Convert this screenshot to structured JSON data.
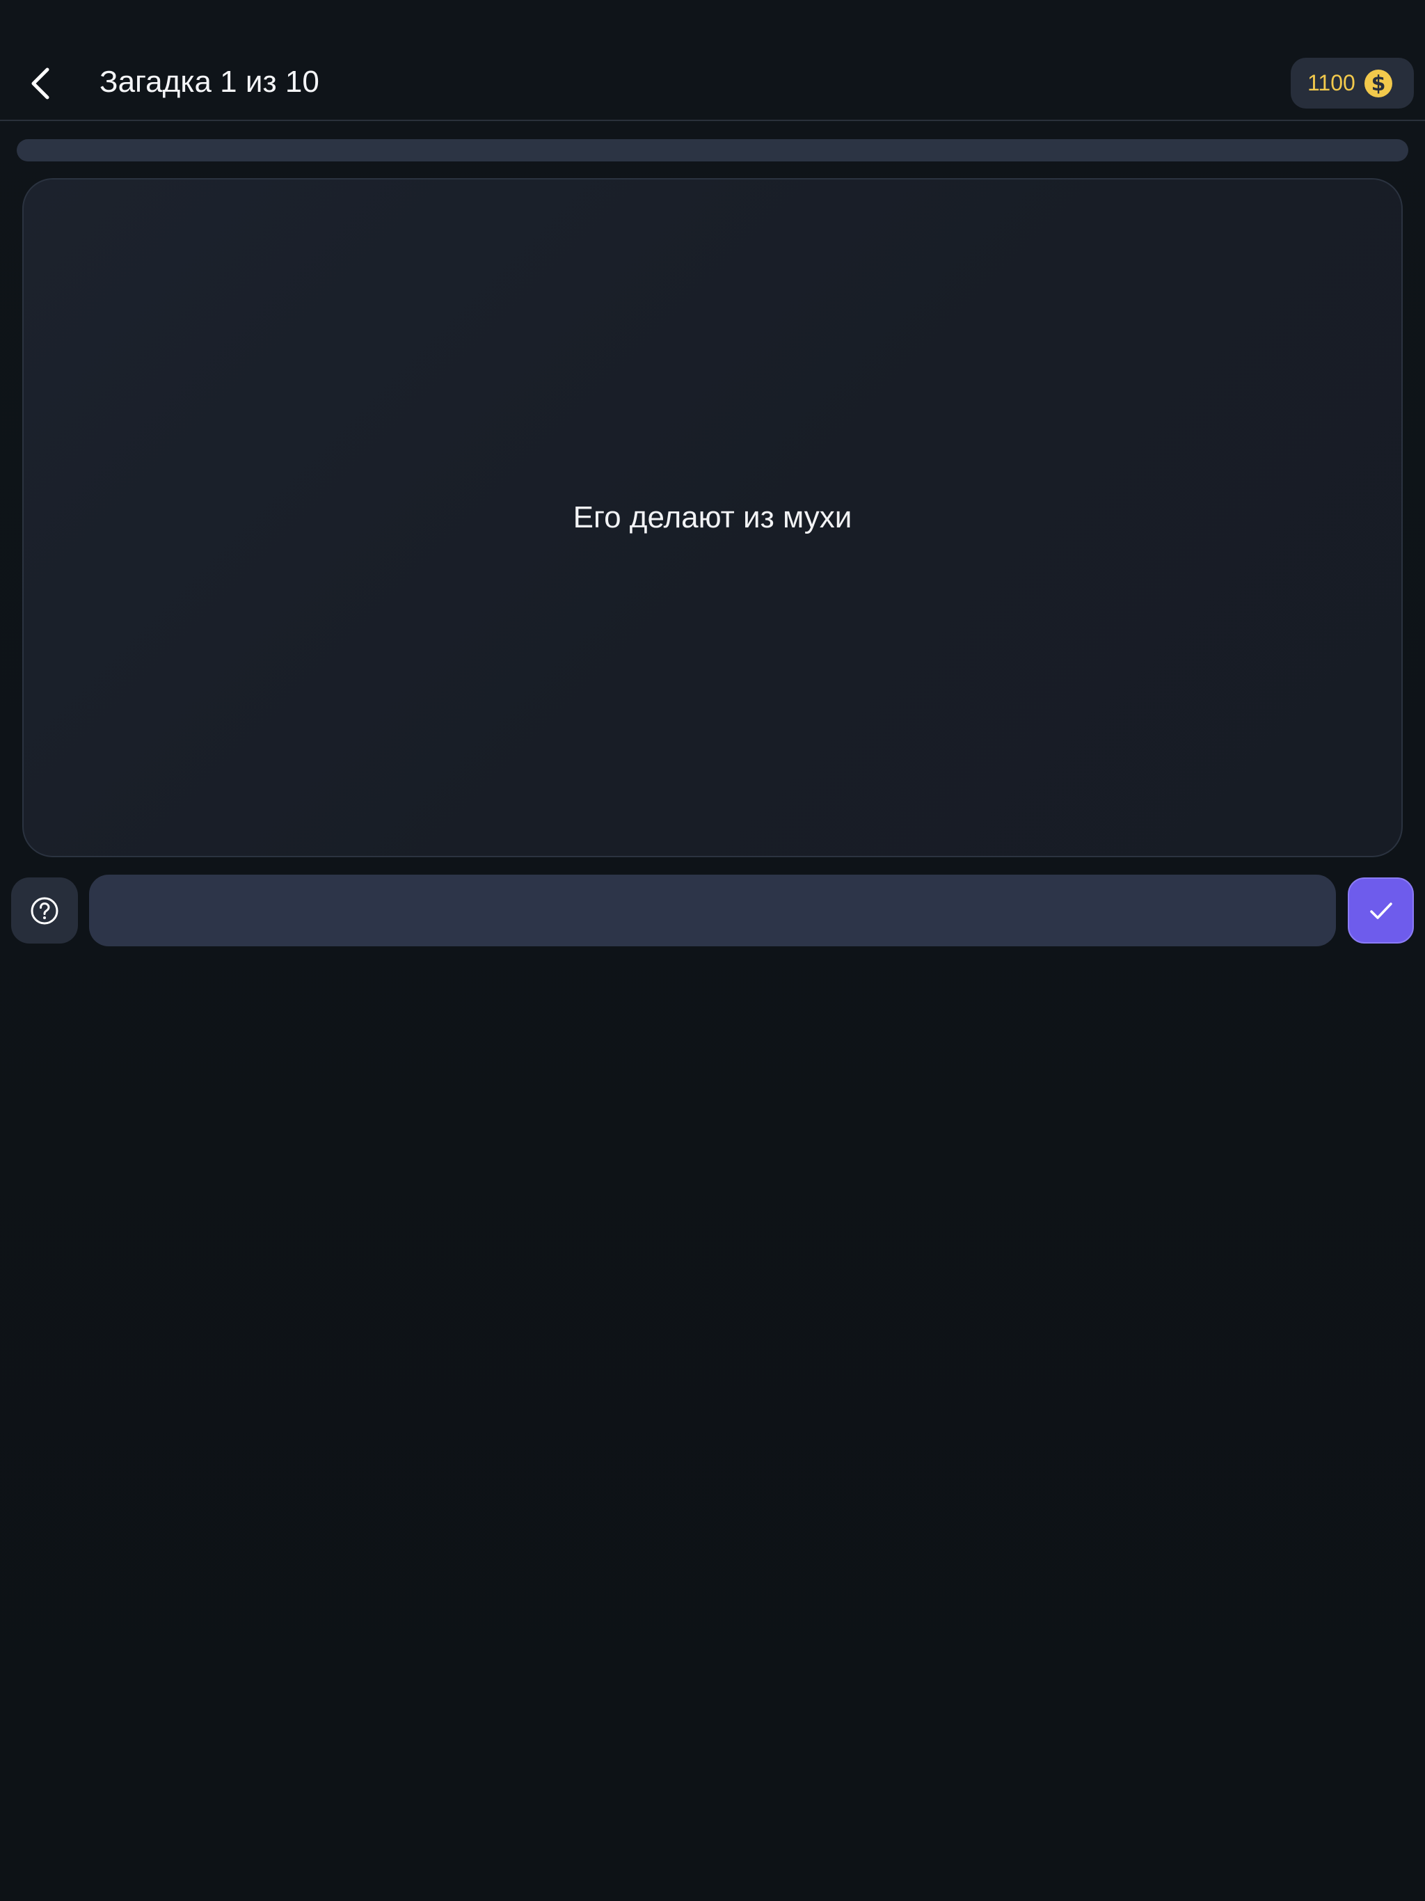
{
  "header": {
    "title": "Загадка 1 из 10",
    "back_icon": "chevron-left-icon"
  },
  "coins": {
    "value": "1100",
    "icon": "dollar-coin-icon",
    "color": "#f2c94c"
  },
  "progress": {
    "fraction": 0.0
  },
  "riddle": {
    "text": "Его делают из мухи"
  },
  "answer": {
    "value": "",
    "placeholder": ""
  },
  "actions": {
    "hint_icon": "question-circle-icon",
    "submit_icon": "checkmark-icon"
  },
  "colors": {
    "background": "#0e1318",
    "accent": "#6e5cec",
    "surface": "#272e3b"
  }
}
